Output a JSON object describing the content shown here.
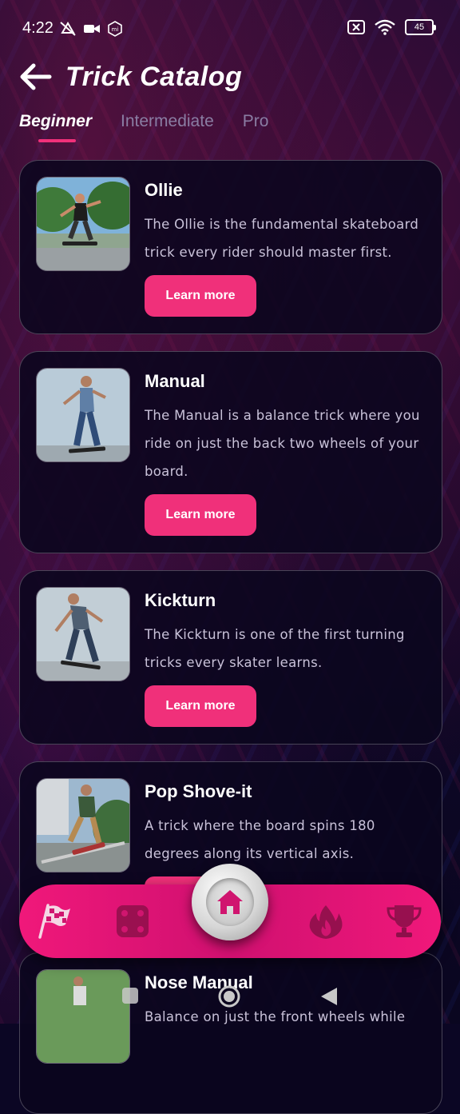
{
  "status_bar": {
    "time": "4:22",
    "battery": "45"
  },
  "header": {
    "title": "Trick Catalog"
  },
  "tabs": [
    {
      "label": "Beginner",
      "active": true
    },
    {
      "label": "Intermediate",
      "active": false
    },
    {
      "label": "Pro",
      "active": false
    }
  ],
  "tricks": [
    {
      "name": "Ollie",
      "description": "The Ollie is the fundamental skateboard trick every rider should master first.",
      "button": "Learn more"
    },
    {
      "name": "Manual",
      "description": "The Manual is a balance trick where you ride on just the back two wheels of your board.",
      "button": "Learn more"
    },
    {
      "name": "Kickturn",
      "description": "The Kickturn is one of the first turning tricks every skater learns.",
      "button": "Learn more"
    },
    {
      "name": "Pop Shove-it",
      "description": "A trick where the board spins 180 degrees along its vertical axis.",
      "button": "Learn more"
    },
    {
      "name": "Nose Manual",
      "description": "Balance on just the front wheels while"
    }
  ],
  "bottom_nav": {
    "items": [
      "checkered-flag-icon",
      "dice-icon",
      "home-icon",
      "fire-icon",
      "trophy-icon"
    ],
    "active": "home-icon",
    "accent_color": "#f0187a"
  },
  "colors": {
    "accent": "#f0307a",
    "background": "#0b0624"
  }
}
